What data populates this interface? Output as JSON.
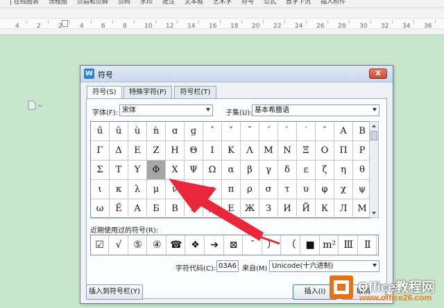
{
  "ribbon": {
    "items": [
      "| 在线图表",
      "流程图",
      "页眉和页脚",
      "页码",
      "水印",
      "批注",
      "文本框",
      "艺术字",
      "符号",
      "公式",
      "首字下沉",
      "插入附件"
    ]
  },
  "ruler": {
    "numbers": [
      "4",
      "2",
      "2",
      "4",
      "6",
      "8",
      "10",
      "12",
      "14",
      "16",
      "18",
      "20",
      "22",
      "24",
      "26",
      "28",
      "30",
      "32",
      "34",
      "36",
      "38"
    ]
  },
  "dialog": {
    "title": "符号",
    "close_label": "X",
    "tabs": [
      {
        "label": "符号(S)",
        "active": true
      },
      {
        "label": "特殊字符(P)",
        "active": false
      },
      {
        "label": "符号栏(T)",
        "active": false
      }
    ],
    "font_label": "字体(F):",
    "font_value": "宋体",
    "subset_label": "子集(U):",
    "subset_value": "基本希腊语",
    "symbols": [
      [
        "ű",
        "ŭ",
        "ù",
        "ǹ",
        "ɑ",
        "ɡ",
        "ˆ",
        "ˇ",
        "ˉ",
        "ˊ",
        "ˋ",
        "˙",
        "˜",
        "Α",
        "Β"
      ],
      [
        "Γ",
        "Δ",
        "Ε",
        "Ζ",
        "Η",
        "Θ",
        "Ι",
        "Κ",
        "Λ",
        "Μ",
        "Ν",
        "Ξ",
        "Ο",
        "Π",
        "Ρ"
      ],
      [
        "Σ",
        "Τ",
        "Υ",
        "Φ",
        "Χ",
        "Ψ",
        "Ω",
        "α",
        "β",
        "γ",
        "δ",
        "ε",
        "ζ",
        "η",
        "θ"
      ],
      [
        "ι",
        "κ",
        "λ",
        "μ",
        "ν",
        "ξ",
        "ο",
        "π",
        "ρ",
        "σ",
        "τ",
        "υ",
        "φ",
        "χ",
        "ψ"
      ],
      [
        "ω",
        "Ё",
        "А",
        "Б",
        "В",
        "Г",
        "Д",
        "Е",
        "Ж",
        "З",
        "И",
        "Й",
        "К",
        "Л",
        "М"
      ]
    ],
    "selected_symbol": "Φ",
    "recent_label": "近期使用过的符号(R):",
    "recent_symbols": [
      "☑",
      "√",
      "⑤",
      "④",
      "☎",
      "❖",
      "➔",
      "⊠",
      "¯",
      "）",
      "（",
      "■",
      "m²",
      "Ⅲ",
      "Ⅱ"
    ],
    "code_label": "字符代码(C):",
    "code_value": "03A6",
    "from_label": "来自(M)",
    "from_value": "Unicode(十六进制)",
    "insert_to_bar_label": "插入到符号栏(Y)",
    "insert_label": "插入(I)",
    "cancel_label": "取消"
  },
  "watermark": {
    "brand": "Office教程网",
    "url": "www.office26.com"
  },
  "colors": {
    "background": "#c8e6cc",
    "selected_cell": "#a6a6a6",
    "annotation_arrow": "#e8283a",
    "logo_orange": "#e2731b"
  }
}
